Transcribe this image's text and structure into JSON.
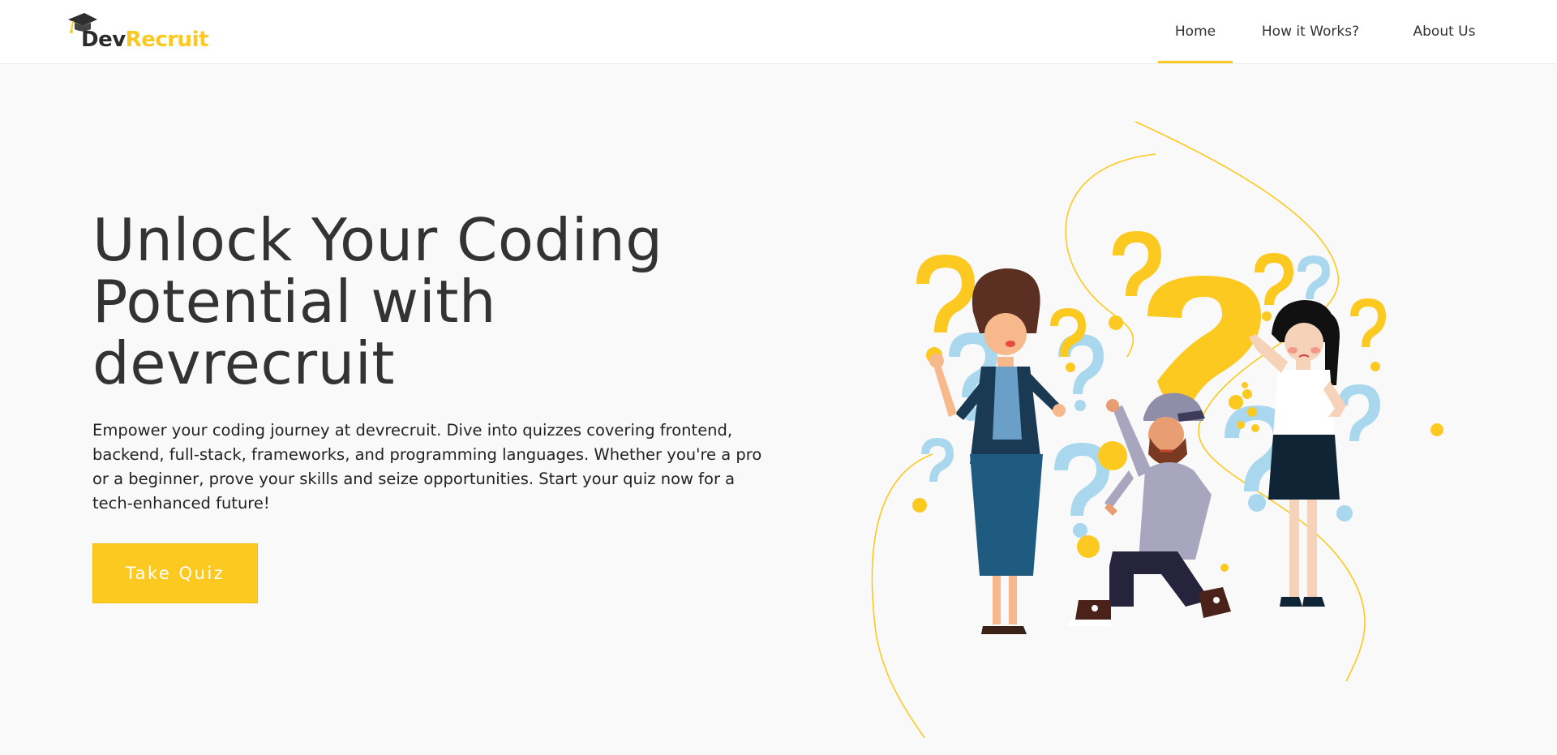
{
  "brand": {
    "part1": "Dev",
    "part2": "Recruit"
  },
  "nav": {
    "items": [
      {
        "label": "Home",
        "active": true
      },
      {
        "label": "How it Works?",
        "active": false
      },
      {
        "label": "About Us",
        "active": false
      }
    ]
  },
  "hero": {
    "title": "Unlock Your Coding Potential with devrecruit",
    "description": "Empower your coding journey at devrecruit. Dive into quizzes covering frontend, backend, full-stack, frameworks, and programming languages. Whether you're a pro or a beginner, prove your skills and seize opportunities. Start your quiz now for a tech-enhanced future!",
    "cta_label": "Take Quiz"
  },
  "colors": {
    "accent": "#fcc920",
    "text": "#333333",
    "background": "#f9f9f9",
    "light_blue": "#a9d8ee"
  },
  "icons": {
    "logo": "graduation-cap-icon"
  }
}
